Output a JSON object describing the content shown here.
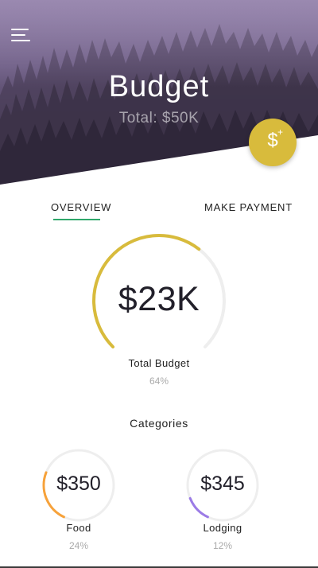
{
  "header": {
    "title": "Budget",
    "subtitle": "Total: $50K",
    "add_button_symbol": "$",
    "add_button_plus": "+"
  },
  "tabs": [
    {
      "label": "OVERVIEW",
      "active": true
    },
    {
      "label": "MAKE PAYMENT",
      "active": false
    }
  ],
  "summary": {
    "amount": "$23K",
    "label": "Total Budget",
    "percent_text": "64%",
    "percent": 64
  },
  "categories": {
    "heading": "Categories",
    "items": [
      {
        "amount": "$350",
        "label": "Food",
        "percent_text": "24%",
        "percent": 24,
        "color": "#f7a23a"
      },
      {
        "amount": "$345",
        "label": "Lodging",
        "percent_text": "12%",
        "percent": 12,
        "color": "#9b7be6"
      }
    ]
  },
  "colors": {
    "accent_gold": "#d8bb3c",
    "tab_underline": "#2fa86b",
    "ring_track": "#eeeeee"
  },
  "icons": {
    "menu": "hamburger-menu-icon",
    "add": "add-money-icon"
  }
}
